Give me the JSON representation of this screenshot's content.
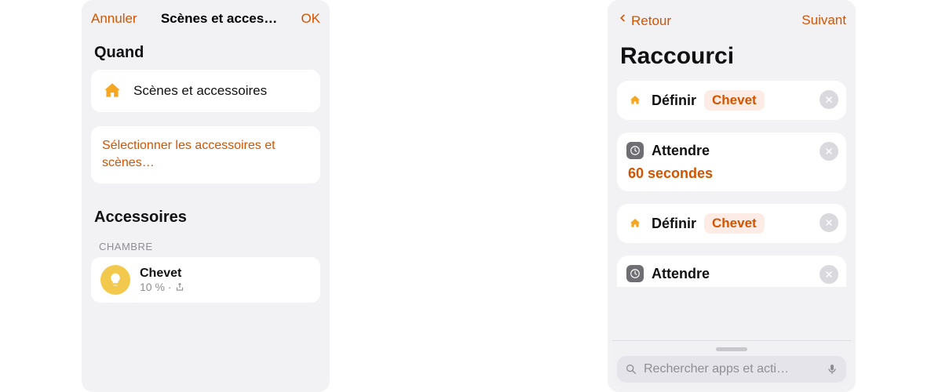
{
  "left": {
    "header": {
      "cancel": "Annuler",
      "title": "Scènes et acces…",
      "ok": "OK"
    },
    "section_when": "Quand",
    "scenes_card": {
      "label": "Scènes et accessoires"
    },
    "select_card": {
      "label": "Sélectionner les accessoires et scènes…"
    },
    "section_acc": "Accessoires",
    "room_label": "CHAMBRE",
    "accessory": {
      "name": "Chevet",
      "sub": "10 % ·"
    }
  },
  "right": {
    "header": {
      "back": "Retour",
      "next": "Suivant"
    },
    "title": "Raccourci",
    "actions": [
      {
        "icon": "home",
        "verb": "Définir",
        "chip": "Chevet"
      },
      {
        "icon": "clock",
        "verb": "Attendre",
        "value": "60 secondes"
      },
      {
        "icon": "home",
        "verb": "Définir",
        "chip": "Chevet"
      },
      {
        "icon": "clock",
        "verb": "Attendre"
      }
    ],
    "search_placeholder": "Rechercher apps et acti…"
  }
}
